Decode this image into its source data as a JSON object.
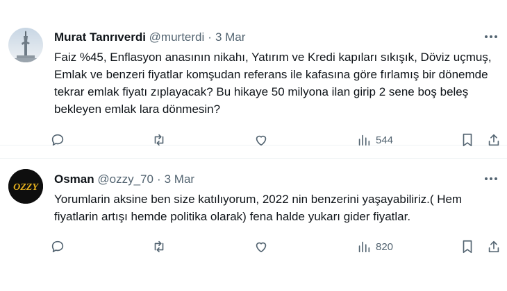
{
  "tweets": [
    {
      "name": "Murat Tanrıverdi",
      "handle": "@murterdi",
      "date": "3 Mar",
      "text": "Faiz %45, Enflasyon anasının nikahı, Yatırım ve Kredi kapıları sıkışık, Döviz uçmuş, Emlak ve benzeri fiyatlar komşudan referans ile kafasına göre fırlamış bir dönemde tekrar emlak fiyatı zıplayacak? Bu hikaye 50 milyona ilan girip 2 sene boş beleş bekleyen emlak lara dönmesin?",
      "views": "544"
    },
    {
      "name": "Osman",
      "handle": "@ozzy_70",
      "date": "3 Mar",
      "text": "Yorumlarin aksine ben size katılıyorum, 2022 nin benzerini yaşayabiliriz.( Hem fiyatlarin artışı hemde politika olarak) fena halde yukarı gider fiyatlar.",
      "views": "820",
      "avatar_text": "OZZY"
    }
  ],
  "separator": "·",
  "colors": {
    "text": "#0f1419",
    "muted": "#536471",
    "border": "#eff3f4"
  },
  "icons": [
    "reply-icon",
    "retweet-icon",
    "like-icon",
    "views-icon",
    "bookmark-icon",
    "share-icon",
    "more-icon"
  ]
}
